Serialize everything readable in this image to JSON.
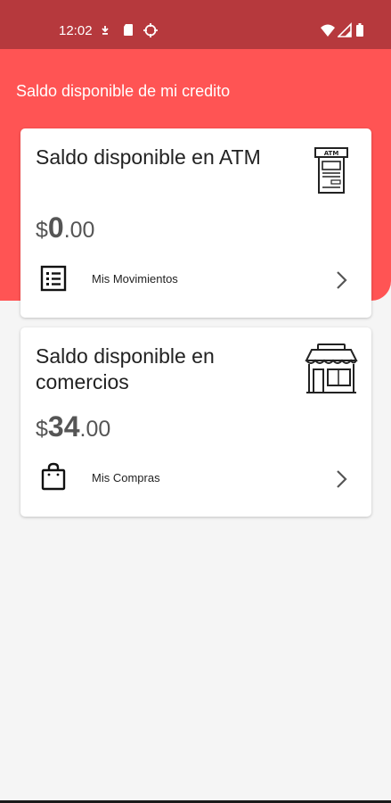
{
  "status_bar": {
    "time": "12:02",
    "background": "#b6393d",
    "icons": [
      "download-notification-icon",
      "sim-card-icon",
      "target-icon",
      "wifi-icon",
      "signal-icon",
      "battery-icon"
    ]
  },
  "header": {
    "title": "Saldo disponible de mi credito",
    "background": "#ff5454"
  },
  "cards": [
    {
      "title": "Saldo disponible en ATM",
      "currency": "$",
      "amount_int": "0",
      "amount_dec": ".00",
      "link_label": "Mis Movimientos",
      "image_icon": "atm-icon",
      "link_icon": "list-icon"
    },
    {
      "title": "Saldo disponible en comercios",
      "currency": "$",
      "amount_int": "34",
      "amount_dec": ".00",
      "link_label": "Mis Compras",
      "image_icon": "store-icon",
      "link_icon": "shopping-bag-icon"
    }
  ]
}
